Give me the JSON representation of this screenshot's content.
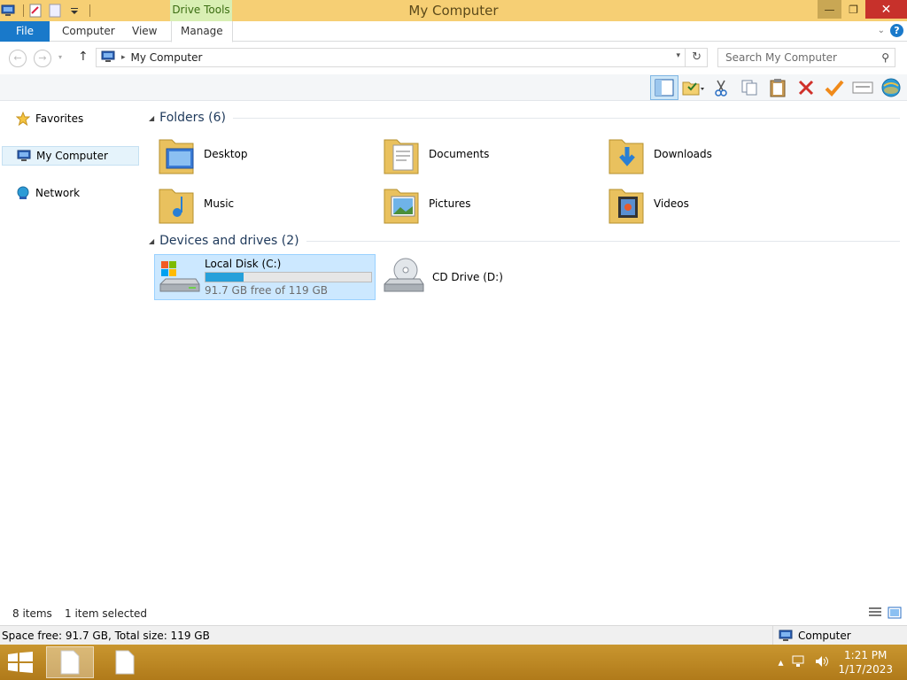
{
  "window": {
    "title": "My Computer",
    "context_tab_group": "Drive Tools",
    "controls": {
      "minimize": "—",
      "maximize": "❐",
      "close": "✕"
    }
  },
  "ribbon": {
    "tabs": [
      {
        "label": "File"
      },
      {
        "label": "Computer"
      },
      {
        "label": "View"
      },
      {
        "label": "Manage"
      }
    ]
  },
  "address": {
    "path": "My Computer",
    "search_placeholder": "Search My Computer"
  },
  "nav": {
    "items": [
      {
        "label": "Favorites",
        "icon": "star-icon"
      },
      {
        "label": "My Computer",
        "icon": "computer-icon",
        "selected": true
      },
      {
        "label": "Network",
        "icon": "network-icon"
      }
    ]
  },
  "content": {
    "folders_header": "Folders (6)",
    "folders": [
      {
        "label": "Desktop",
        "icon": "desktop-folder-icon"
      },
      {
        "label": "Documents",
        "icon": "documents-folder-icon"
      },
      {
        "label": "Downloads",
        "icon": "downloads-folder-icon"
      },
      {
        "label": "Music",
        "icon": "music-folder-icon"
      },
      {
        "label": "Pictures",
        "icon": "pictures-folder-icon"
      },
      {
        "label": "Videos",
        "icon": "videos-folder-icon"
      }
    ],
    "drives_header": "Devices and drives (2)",
    "drives": [
      {
        "label": "Local Disk (C:)",
        "free_text": "91.7 GB free of 119 GB",
        "used_fraction": 0.23,
        "selected": true
      },
      {
        "label": "CD Drive (D:)"
      }
    ]
  },
  "status": {
    "item_count": "8 items",
    "selection": "1 item selected",
    "space": "Space free: 91.7 GB, Total size: 119 GB",
    "zone": "Computer"
  },
  "taskbar": {
    "time": "1:21 PM",
    "date": "1/17/2023"
  },
  "colors": {
    "title_bar": "#f6cf74",
    "file_tab": "#1979ca",
    "selection": "#cce8ff",
    "drive_fill": "#26a0da",
    "taskbar": "#b07a1a"
  }
}
